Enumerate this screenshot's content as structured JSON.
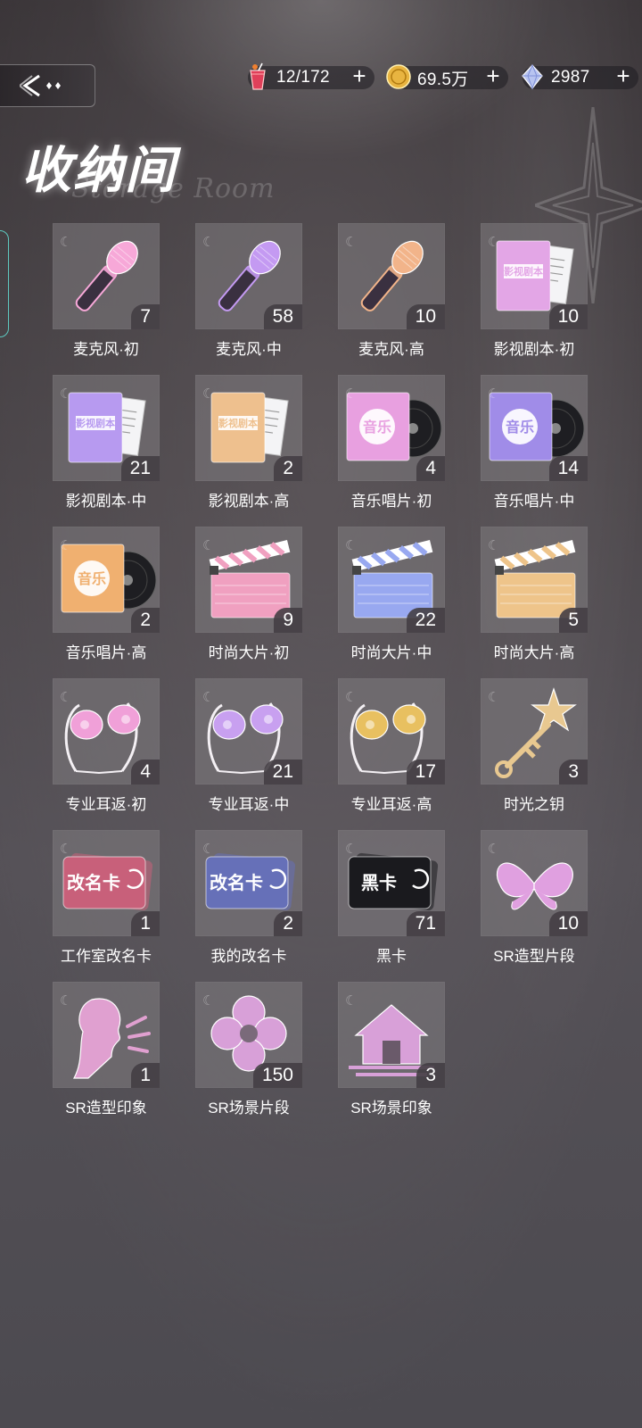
{
  "header": {
    "title": "收纳间",
    "subtitle": "Storage Room"
  },
  "resources": {
    "energy": {
      "value": "12/172",
      "icon": "drink-icon"
    },
    "coins": {
      "value": "69.5万",
      "icon": "coin-icon"
    },
    "diamonds": {
      "value": "2987",
      "icon": "diamond-icon"
    },
    "plus_label": "+"
  },
  "items": [
    {
      "label": "麦克风·初",
      "count": "7",
      "icon": "microphone-pink-icon",
      "color": "#f7a8d8"
    },
    {
      "label": "麦克风·中",
      "count": "58",
      "icon": "microphone-purple-icon",
      "color": "#c49af2"
    },
    {
      "label": "麦克风·高",
      "count": "10",
      "icon": "microphone-gold-icon",
      "color": "#f2b48a"
    },
    {
      "label": "影视剧本·初",
      "count": "10",
      "icon": "script-pink-icon",
      "color": "#e3a6e6",
      "card_text": "影视剧本"
    },
    {
      "label": "影视剧本·中",
      "count": "21",
      "icon": "script-purple-icon",
      "color": "#b79af0",
      "card_text": "影视剧本"
    },
    {
      "label": "影视剧本·高",
      "count": "2",
      "icon": "script-gold-icon",
      "color": "#eec08e",
      "card_text": "影视剧本"
    },
    {
      "label": "音乐唱片·初",
      "count": "4",
      "icon": "record-pink-icon",
      "color": "#e8a0e0",
      "card_text": "音乐"
    },
    {
      "label": "音乐唱片·中",
      "count": "14",
      "icon": "record-purple-icon",
      "color": "#a08ce8",
      "card_text": "音乐"
    },
    {
      "label": "音乐唱片·高",
      "count": "2",
      "icon": "record-gold-icon",
      "color": "#f0b070",
      "card_text": "音乐"
    },
    {
      "label": "时尚大片·初",
      "count": "9",
      "icon": "clapperboard-pink-icon",
      "color": "#f0a0c0"
    },
    {
      "label": "时尚大片·中",
      "count": "22",
      "icon": "clapperboard-blue-icon",
      "color": "#98a8f0"
    },
    {
      "label": "时尚大片·高",
      "count": "5",
      "icon": "clapperboard-gold-icon",
      "color": "#eec48a"
    },
    {
      "label": "专业耳返·初",
      "count": "4",
      "icon": "in-ear-monitor-pink-icon",
      "color": "#f0a0d8"
    },
    {
      "label": "专业耳返·中",
      "count": "21",
      "icon": "in-ear-monitor-purple-icon",
      "color": "#c8a0f0"
    },
    {
      "label": "专业耳返·高",
      "count": "17",
      "icon": "in-ear-monitor-gold-icon",
      "color": "#e8c060"
    },
    {
      "label": "时光之钥",
      "count": "3",
      "icon": "star-key-icon",
      "color": "#e8c890"
    },
    {
      "label": "工作室改名卡",
      "count": "1",
      "icon": "rename-card-pink-icon",
      "color": "#c8607a",
      "card_text": "改名卡"
    },
    {
      "label": "我的改名卡",
      "count": "2",
      "icon": "rename-card-blue-icon",
      "color": "#6670b8",
      "card_text": "改名卡"
    },
    {
      "label": "黑卡",
      "count": "71",
      "icon": "black-card-icon",
      "color": "#1a1a1e",
      "card_text": "黑卡"
    },
    {
      "label": "SR造型片段",
      "count": "10",
      "icon": "butterfly-icon",
      "color": "#e0a0e0"
    },
    {
      "label": "SR造型印象",
      "count": "1",
      "icon": "profile-silhouette-icon",
      "color": "#e0a0d0"
    },
    {
      "label": "SR场景片段",
      "count": "150",
      "icon": "clover-icon",
      "color": "#d8a0d8"
    },
    {
      "label": "SR场景印象",
      "count": "3",
      "icon": "house-icon",
      "color": "#d8a0d8"
    }
  ]
}
